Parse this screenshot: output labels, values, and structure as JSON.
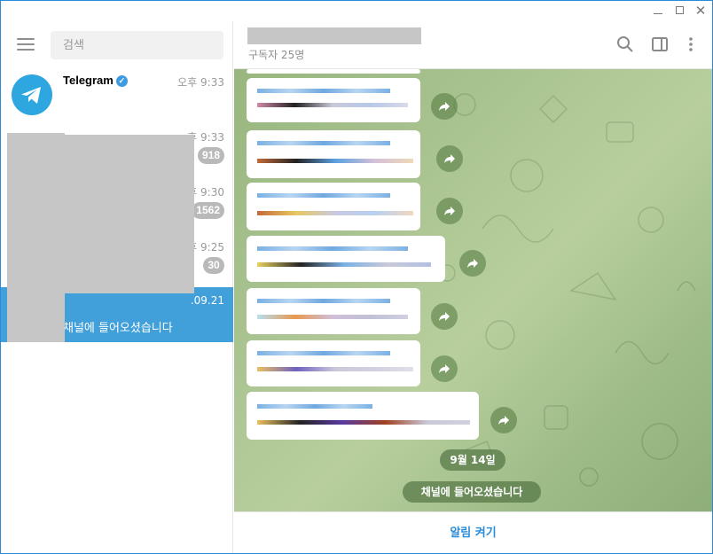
{
  "window": {
    "controls": {
      "minimize": "minimize",
      "maximize": "maximize",
      "close": "close"
    }
  },
  "sidebar": {
    "search_placeholder": "검색",
    "chats": [
      {
        "name": "Telegram",
        "verified": true,
        "time": "오후 9:33"
      },
      {
        "name": "",
        "time": "후 9:33",
        "badge": "918"
      },
      {
        "name": "",
        "time": "후 9:30",
        "badge": "1562"
      },
      {
        "name": "",
        "time": "후 9:25",
        "badge": "30"
      },
      {
        "name": "",
        "time": ".09.21",
        "preview": "채널에 들어오셨습니다",
        "active": true
      }
    ]
  },
  "header": {
    "subscribers": "구독자 25명"
  },
  "chat": {
    "date_pill": "9월 14일",
    "service_msg": "채널에 들어오셨습니다"
  },
  "bottom": {
    "unmute_label": "알림 켜기"
  },
  "colors": {
    "accent": "#419fd9",
    "link": "#2a8bd9",
    "badge": "#b9b9b9"
  },
  "icons": [
    "menu-icon",
    "search-icon",
    "sidebar-toggle-icon",
    "more-vertical-icon",
    "share-icon",
    "verified-icon",
    "telegram-logo-icon"
  ]
}
